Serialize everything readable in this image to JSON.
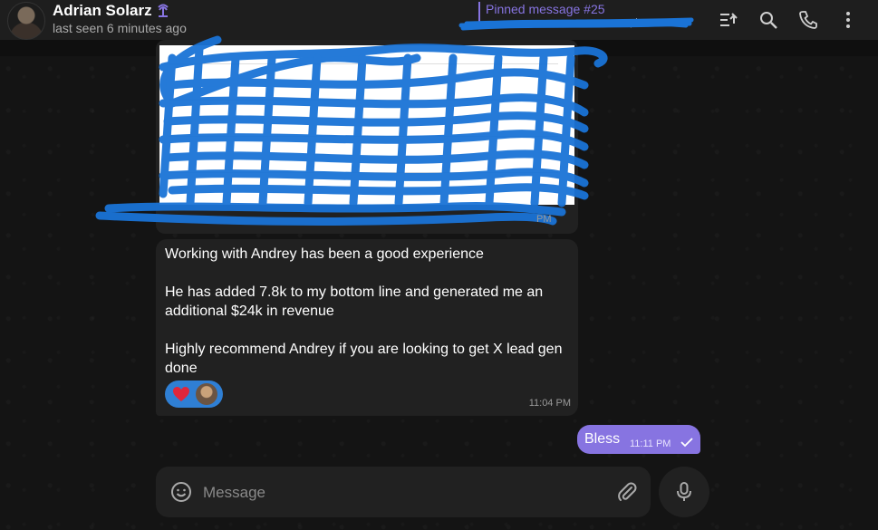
{
  "header": {
    "name": "Adrian Solarz",
    "status": "last seen 6 minutes ago",
    "badge_icon": "palm-tree-icon",
    "pinned_title": "Pinned message #25",
    "pinned_preview": "...ph...",
    "actions": [
      "pinned-list-icon",
      "search-icon",
      "phone-icon",
      "more-vertical-icon"
    ]
  },
  "messages": {
    "image_time": "PM",
    "incoming": {
      "para1": "Working with Andrey has been a good experience",
      "para2": "He has added 7.8k to my bottom line and generated me an additional $24k in revenue",
      "para3": "Highly recommend Andrey if you are looking to get X lead gen done",
      "time": "11:04 PM",
      "reactions": [
        "heart-icon",
        "user-avatar"
      ]
    },
    "outgoing": {
      "text": "Bless",
      "time": "11:11 PM",
      "status_icon": "check-icon"
    }
  },
  "composer": {
    "placeholder": "Message",
    "value": ""
  },
  "colors": {
    "accent": "#8774e1",
    "bubble_in": "#212121",
    "background": "#0f0f0f",
    "scribble": "#1a73d6"
  }
}
